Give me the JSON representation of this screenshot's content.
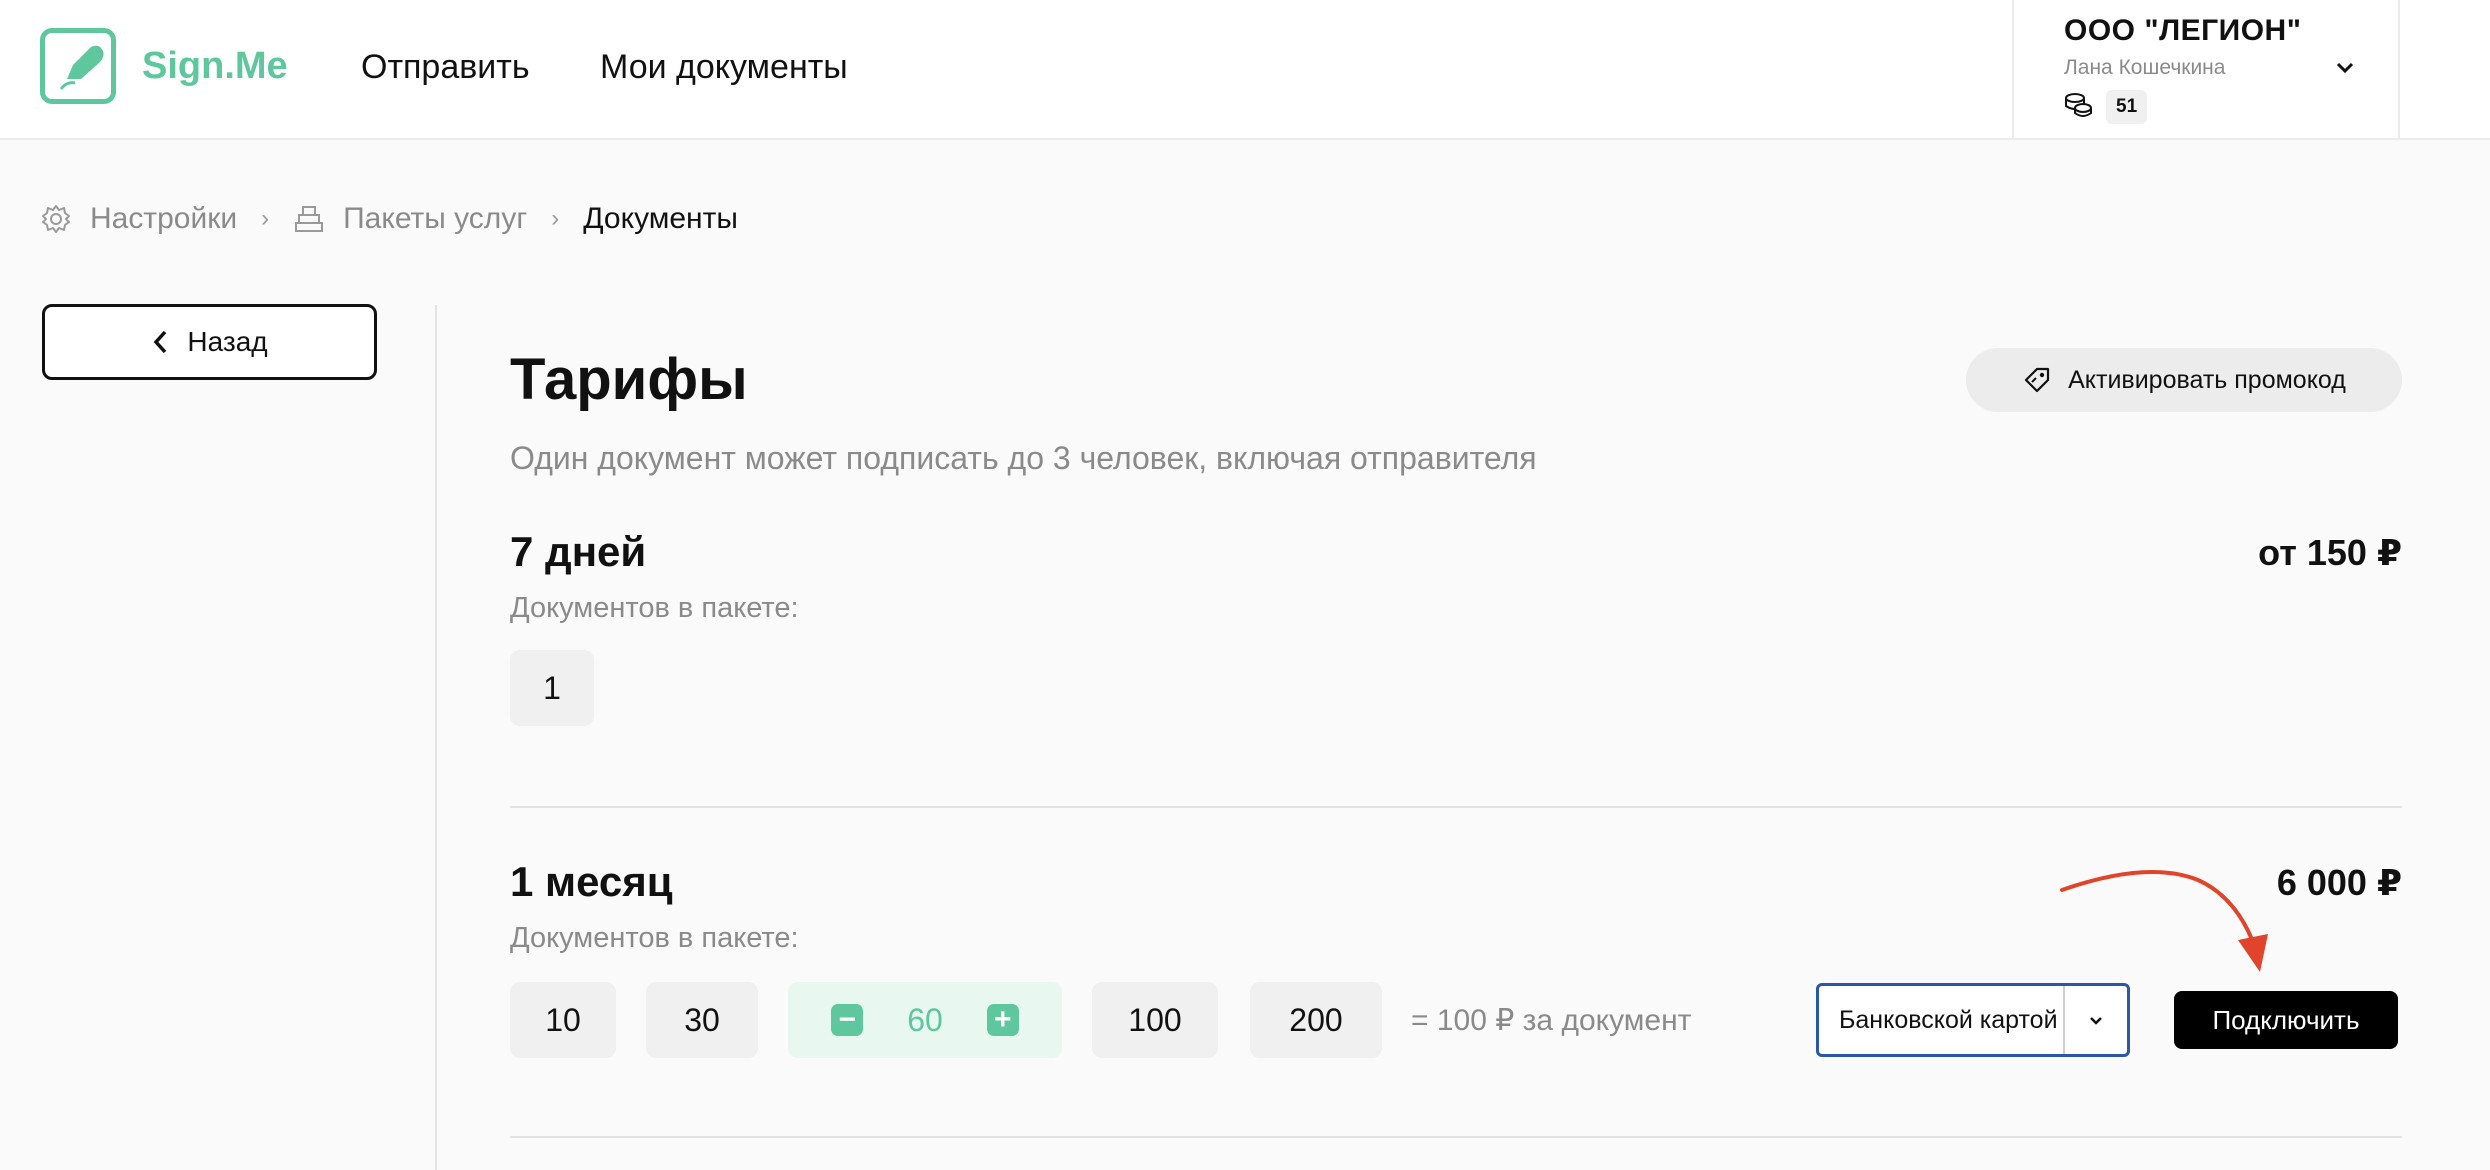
{
  "header": {
    "logo_text": "Sign.Me",
    "nav": [
      "Отправить",
      "Мои документы"
    ],
    "account": {
      "org": "ООО \"ЛЕГИОН\"",
      "user": "Лана Кошечкина",
      "coins": "51"
    }
  },
  "breadcrumb": {
    "settings": "Настройки",
    "packages": "Пакеты услуг",
    "current": "Документы"
  },
  "sidebar": {
    "back_label": "Назад"
  },
  "main": {
    "title": "Тарифы",
    "promo_label": "Активировать промокод",
    "subtitle": "Один документ может подписать до 3 человек, включая отправителя",
    "plans": [
      {
        "name": "7 дней",
        "price": "от 150 ₽",
        "label": "Документов в пакете:",
        "options": [
          "1"
        ]
      },
      {
        "name": "1 месяц",
        "price": "6 000 ₽",
        "label": "Документов в пакете:",
        "options": [
          "10",
          "30",
          "60",
          "100",
          "200"
        ],
        "selected": "60",
        "per_doc": "= 100 ₽ за документ",
        "payment_method": "Банковской картой",
        "connect_label": "Подключить"
      }
    ]
  },
  "colors": {
    "accent": "#5ec79e",
    "select_border": "#2a57a6",
    "arrow": "#e0452b"
  }
}
